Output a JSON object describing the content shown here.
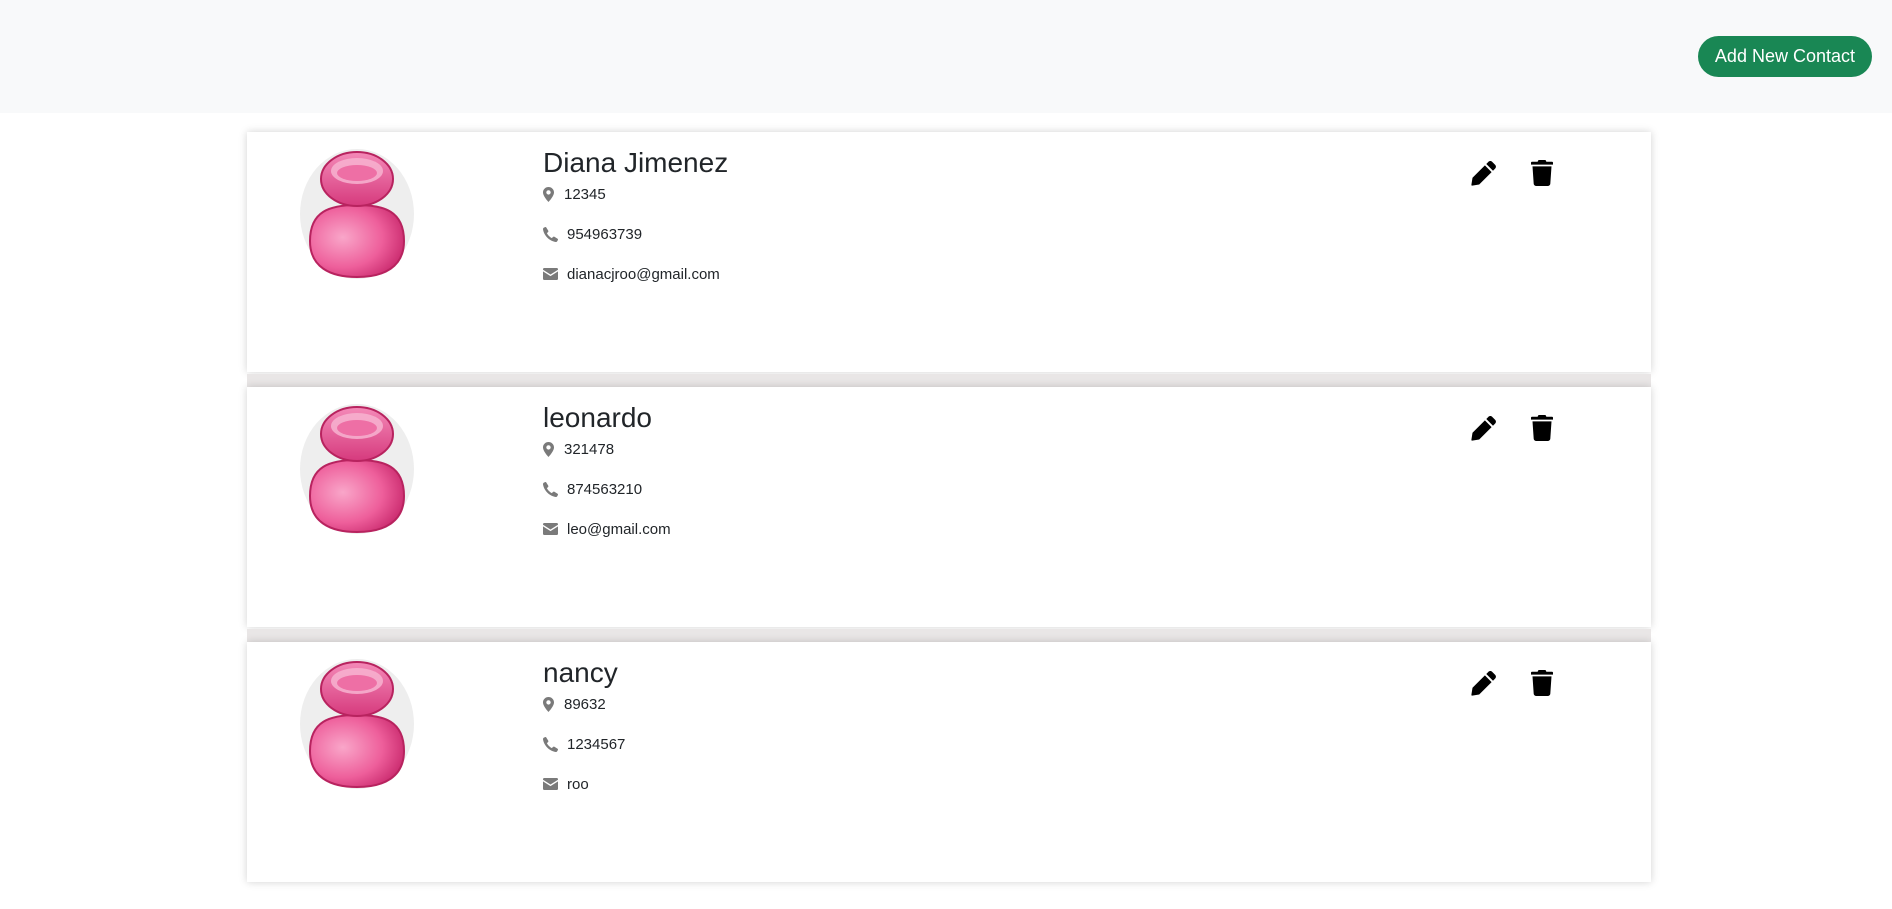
{
  "header": {
    "add_button_label": "Add New Contact"
  },
  "colors": {
    "navbar_bg": "#f8f9fa",
    "button_green": "#198754",
    "avatar_pink": "#e94c8f",
    "icon_gray": "#7a7a7a"
  },
  "contacts": [
    {
      "name": "Diana Jimenez",
      "address": "12345",
      "phone": "954963739",
      "email": "dianacjroo@gmail.com"
    },
    {
      "name": "leonardo",
      "address": "321478",
      "phone": "874563210",
      "email": "leo@gmail.com"
    },
    {
      "name": "nancy",
      "address": "89632",
      "phone": "1234567",
      "email": "roo"
    }
  ],
  "icons": {
    "avatar": "person-avatar-icon",
    "address": "map-marker-icon",
    "phone": "phone-icon",
    "email": "envelope-icon",
    "edit": "pencil-icon",
    "delete": "trash-icon"
  }
}
